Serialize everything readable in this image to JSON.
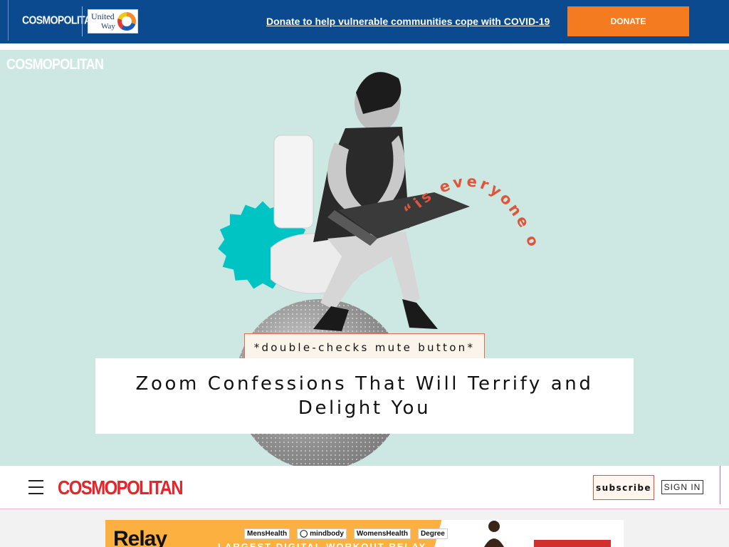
{
  "banner": {
    "brand": "COSMOPOLITAN",
    "partner_line1": "United",
    "partner_line2": "Way",
    "message": "Donate to help vulnerable communities cope with COVID-19",
    "donate_label": "DONATE"
  },
  "hero": {
    "brand": "COSMOPOLITAN",
    "quote": "“is everyone on?”",
    "tagline": "*double-checks mute button*",
    "headline_line1": "Zoom Confessions That Will Terrify and",
    "headline_line2": "Delight You"
  },
  "nav": {
    "brand": "COSMOPOLITAN",
    "subscribe_label": "subscribe",
    "signin_label": "SIGN IN"
  },
  "ad": {
    "title": "Relay",
    "brands": [
      "MensHealth",
      "mindbody",
      "WomensHealth",
      "Degree"
    ],
    "slogan": "LARGEST DIGITAL WORKOUT RELAY"
  },
  "colors": {
    "banner_bg": "#0b4a8f",
    "donate_button": "#f47b20",
    "hero_bg": "#cde8e2",
    "brand_red": "#e8232a",
    "quote_color": "#e0553a",
    "blob": "#00c4c4"
  }
}
